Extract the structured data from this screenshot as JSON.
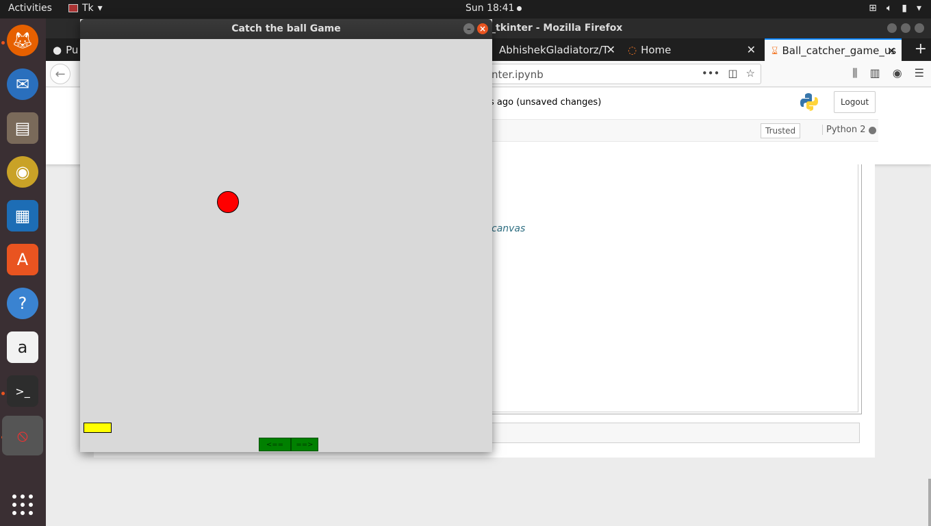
{
  "topbar": {
    "activities": "Activities",
    "app_name": "Tk",
    "clock": "Sun 18:41",
    "tray_icons": [
      "network-icon",
      "volume-icon",
      "battery-icon",
      "chevron-down-icon"
    ]
  },
  "dock": {
    "items": [
      {
        "name": "firefox-icon",
        "color": "#e66000"
      },
      {
        "name": "thunderbird-icon",
        "color": "#2a6fbd"
      },
      {
        "name": "files-icon",
        "color": "#7a6a5a"
      },
      {
        "name": "rhythmbox-icon",
        "color": "#c9a227"
      },
      {
        "name": "writer-icon",
        "color": "#1d6db5"
      },
      {
        "name": "software-icon",
        "color": "#e95420"
      },
      {
        "name": "help-icon",
        "color": "#3a83d1"
      },
      {
        "name": "amazon-icon",
        "color": "#f2f2f2"
      },
      {
        "name": "terminal-icon",
        "color": "#2d2d2d"
      },
      {
        "name": "tk-app-icon",
        "color": "#444444"
      }
    ]
  },
  "firefox": {
    "title": "_tkinter - Mozilla Firefox",
    "tabs": [
      {
        "label": "Pu"
      },
      {
        "label": "AbhishekGladiatorz/T"
      },
      {
        "label": "Home"
      },
      {
        "label": "Ball_catcher_game_us"
      }
    ],
    "url": "nter.ipynb"
  },
  "jupyter": {
    "saved_status": "s ago   (unsaved changes)",
    "logout_label": "Logout",
    "trusted_label": "Trusted",
    "kernel_label": "Python 2",
    "canvas_text": "canvas"
  },
  "tk": {
    "title": "Catch the ball Game",
    "left_button": "<==",
    "right_button": "==>",
    "colors": {
      "ball": "#ff0000",
      "paddle": "#ffff00",
      "buttons": "#008000",
      "canvas": "#d9d9d9"
    }
  }
}
